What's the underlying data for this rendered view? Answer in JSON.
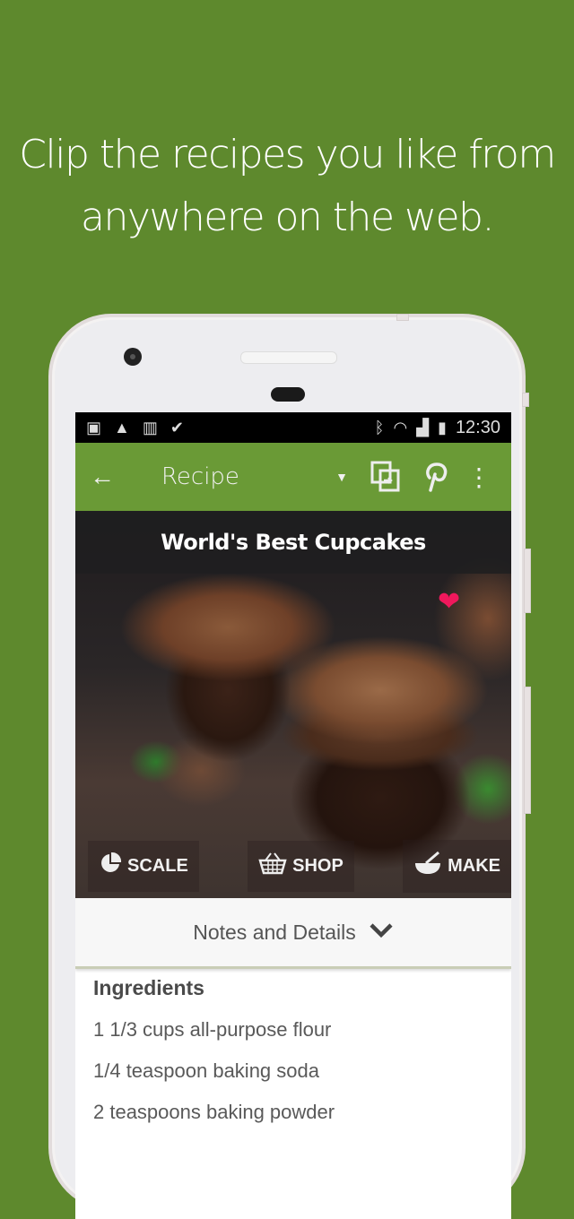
{
  "headline": {
    "line1": "Clip the recipes you like from",
    "line2": "anywhere on the web."
  },
  "status_bar": {
    "left_icons": [
      "image-icon",
      "app-icon",
      "barcode-icon",
      "checkmark-icon"
    ],
    "right_icons": [
      "bluetooth-icon",
      "wifi-icon",
      "signal-icon",
      "battery-icon"
    ],
    "time": "12:30"
  },
  "app_bar": {
    "back_icon": "←",
    "title": "Recipe",
    "dropdown_icon": "▼",
    "share_icon": "⧉",
    "pinterest_icon": "℘",
    "more_icon": "⋮"
  },
  "recipe": {
    "title": "World's Best Cupcakes",
    "favorite_icon": "❤",
    "favorite_color": "#f0185c",
    "actions": [
      {
        "label": "SCALE",
        "icon": "◔"
      },
      {
        "label": "SHOP",
        "icon": "🧺"
      },
      {
        "label": "MAKE",
        "icon": "🥣"
      }
    ]
  },
  "notes": {
    "label": "Notes and Details",
    "chevron": "❯"
  },
  "ingredients": {
    "heading": "Ingredients",
    "items": [
      "1 1/3 cups all-purpose flour",
      "1/4 teaspoon baking soda",
      "2 teaspoons baking powder"
    ]
  },
  "colors": {
    "background": "#5e892d",
    "app_bar": "#6a9a36",
    "status_bar": "#000000"
  }
}
